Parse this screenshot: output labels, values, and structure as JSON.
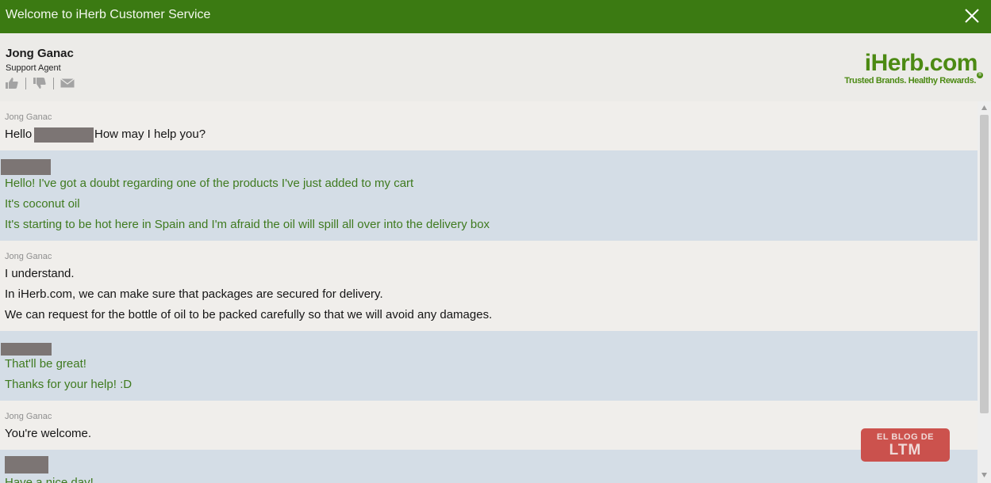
{
  "window": {
    "title": "Welcome to iHerb Customer Service"
  },
  "agent": {
    "name": "Jong Ganac",
    "role": "Support Agent"
  },
  "logo": {
    "wordmark": "iHerb.com",
    "tagline": "Trusted Brands. Healthy Rewards.",
    "registered": "®"
  },
  "colors": {
    "title_bar": "#3b7a12",
    "customer_bg": "#d4dde6",
    "agent_bg": "#f0eeeb",
    "customer_text": "#3f7a1f",
    "brand_green": "#4c8a13"
  },
  "messages": [
    {
      "from": "agent",
      "sender": "Jong Ganac",
      "lines": [
        "Hello",
        "How may I help you?"
      ]
    },
    {
      "from": "customer",
      "lines": [
        "Hello! I've got a doubt regarding one of the products I've just added to my cart",
        "It's coconut oil",
        "It's starting to be hot here in Spain and I'm afraid the oil will spill all over into the delivery box"
      ]
    },
    {
      "from": "agent",
      "sender": "Jong Ganac",
      "lines": [
        "I understand.",
        "In iHerb.com, we can make sure that packages are secured for delivery.",
        "We can request for the bottle of oil to be packed carefully so that we will avoid any damages."
      ]
    },
    {
      "from": "customer",
      "lines": [
        "That'll be great!",
        "Thanks for your help! :D"
      ]
    },
    {
      "from": "agent",
      "sender": "Jong Ganac",
      "lines": [
        "You're welcome."
      ]
    },
    {
      "from": "customer",
      "lines": [
        "Have a nice day!"
      ]
    }
  ],
  "watermark": {
    "line1": "EL BLOG DE",
    "line2": "LTM"
  }
}
